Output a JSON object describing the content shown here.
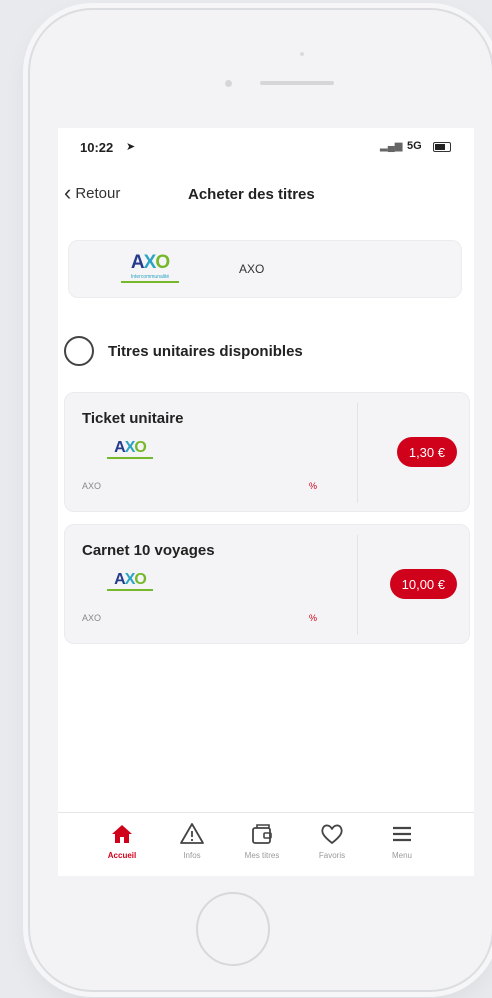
{
  "status": {
    "time": "10:22",
    "location_glyph": "➤",
    "network": "5G"
  },
  "navbar": {
    "back_label": "Retour",
    "title": "Acheter des titres"
  },
  "provider": {
    "name": "AXO",
    "logo": {
      "a": "A",
      "x": "X",
      "o": "O",
      "tagline": "Intercommunalité"
    }
  },
  "section": {
    "label": "Titres unitaires disponibles"
  },
  "tickets": [
    {
      "name": "Ticket unitaire",
      "provider": "AXO",
      "price": "1,30 €",
      "icon": "percent-icon",
      "icon_glyph": "%"
    },
    {
      "name": "Carnet 10 voyages",
      "provider": "AXO",
      "price": "10,00 €",
      "icon": "percent-icon",
      "icon_glyph": "%"
    }
  ],
  "tabbar": [
    {
      "label": "Accueil",
      "icon": "home-icon",
      "active": true
    },
    {
      "label": "Infos",
      "icon": "warning-icon",
      "active": false
    },
    {
      "label": "Mes titres",
      "icon": "wallet-icon",
      "active": false
    },
    {
      "label": "Favoris",
      "icon": "heart-icon",
      "active": false
    },
    {
      "label": "Menu",
      "icon": "menu-icon",
      "active": false
    }
  ],
  "colors": {
    "accent": "#d0021b",
    "logo_blue": "#253b8c",
    "logo_cyan": "#2aa3c4",
    "logo_green": "#76b82a"
  }
}
